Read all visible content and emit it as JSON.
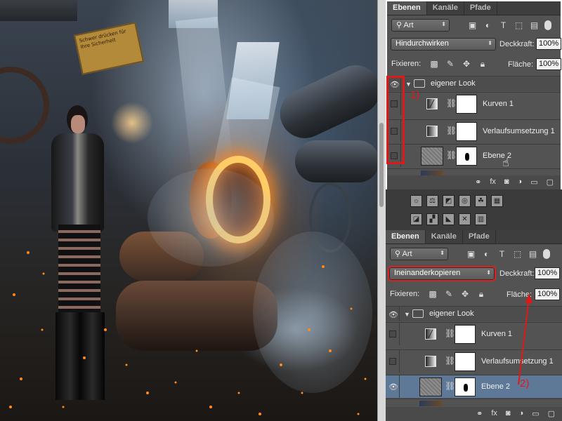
{
  "photo": {
    "sign_text": "Schwer drücken für Ihre Sicherheit"
  },
  "panel_top": {
    "tabs": [
      "Ebenen",
      "Kanäle",
      "Pfade"
    ],
    "kind_label": "Art",
    "filter_icons": [
      "image-icon",
      "adjustment-icon",
      "type-icon",
      "shape-icon",
      "smart-object-icon"
    ],
    "blend_mode": "Hindurchwirken",
    "opacity_label": "Deckkraft:",
    "opacity_value": "100%",
    "lock_label": "Fixieren:",
    "fill_label": "Fläche:",
    "fill_value": "100%",
    "group_name": "eigener Look",
    "layers": [
      {
        "name": "Kurven 1",
        "type": "curves",
        "visible": false
      },
      {
        "name": "Verlaufsumsetzung 1",
        "type": "gradient-map",
        "visible": false
      },
      {
        "name": "Ebene 2",
        "type": "pixel",
        "visible": false
      }
    ],
    "footer_icons": [
      "link-icon",
      "fx-icon",
      "mask-icon",
      "adjustment-icon",
      "folder-icon",
      "new-layer-icon"
    ]
  },
  "panel_bottom": {
    "tabs": [
      "Ebenen",
      "Kanäle",
      "Pfade"
    ],
    "kind_label": "Art",
    "blend_mode": "Ineinanderkopieren",
    "opacity_label": "Deckkraft:",
    "opacity_value": "100%",
    "lock_label": "Fixieren:",
    "fill_label": "Fläche:",
    "fill_value": "100%",
    "group_name": "eigener Look",
    "layers": [
      {
        "name": "Kurven 1",
        "type": "curves",
        "visible": false
      },
      {
        "name": "Verlaufsumsetzung 1",
        "type": "gradient-map",
        "visible": false
      },
      {
        "name": "Ebene 2",
        "type": "pixel",
        "visible": true,
        "selected": true
      }
    ],
    "footer_icons": [
      "link-icon",
      "fx-icon",
      "mask-icon",
      "adjustment-icon",
      "folder-icon",
      "new-layer-icon"
    ]
  },
  "annotations": {
    "step1": "1)",
    "step2": "2)",
    "color": "#e01818"
  },
  "colors": {
    "panel_bg": "#535353",
    "selected_layer": "#5e7897",
    "highlight_red": "#e01818"
  }
}
